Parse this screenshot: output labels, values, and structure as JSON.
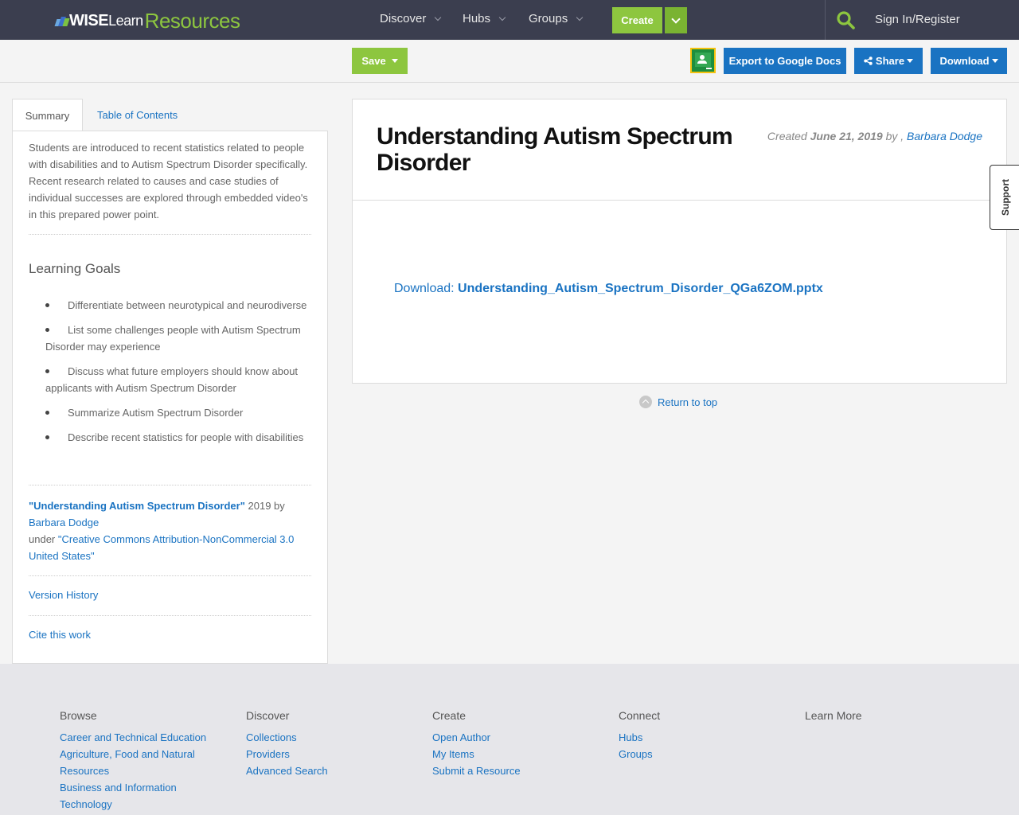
{
  "navbar": {
    "logo": {
      "wise": "WISE",
      "learn": "Learn",
      "resources": "Resources"
    },
    "items": [
      {
        "label": "Discover"
      },
      {
        "label": "Hubs"
      },
      {
        "label": "Groups"
      }
    ],
    "create_label": "Create",
    "signin_label": "Sign In/Register"
  },
  "toolbar": {
    "save_label": "Save",
    "export_label": "Export to Google Docs",
    "share_label": "Share",
    "download_label": "Download"
  },
  "tabs": {
    "summary": "Summary",
    "toc": "Table of Contents"
  },
  "summary": {
    "text": "Students are introduced to recent statistics related to people with disabilities and to Autism Spectrum Disorder specifically. Recent research related to causes and case studies of individual successes are explored through embedded video's in this prepared power point.",
    "learning_goals_heading": "Learning Goals",
    "goals": [
      "Differentiate between neurotypical and neurodiverse",
      "List some challenges people with Autism Spectrum Disorder may experience",
      "Discuss what future employers should know about applicants with Autism Spectrum Disorder",
      "Summarize Autism Spectrum Disorder",
      "Describe recent statistics for people with disabilities"
    ],
    "attribution": {
      "title": "\"Understanding Autism Spectrum Disorder\"",
      "year_by": " 2019 by ",
      "author": "Barbara Dodge",
      "under": "under ",
      "license": "\"Creative Commons Attribution-NonCommercial 3.0 United States\""
    },
    "version_history": "Version History",
    "cite": "Cite this work"
  },
  "resource": {
    "title": "Understanding Autism Spectrum Disorder",
    "created_label": "Created ",
    "created_date": "June 21, 2019",
    "by_label": " by , ",
    "author": "Barbara Dodge",
    "download_label": "Download: ",
    "download_file": "Understanding_Autism_Spectrum_Disorder_QGa6ZOM.pptx",
    "return_top": "Return to top",
    "support_label": "Support"
  },
  "footer": {
    "columns": [
      {
        "heading": "Browse",
        "links": [
          "Career and Technical Education",
          "Agriculture, Food and Natural Resources",
          "Business and Information Technology"
        ]
      },
      {
        "heading": "Discover",
        "links": [
          "Collections",
          "Providers",
          "Advanced Search"
        ]
      },
      {
        "heading": "Create",
        "links": [
          "Open Author",
          "My Items",
          "Submit a Resource"
        ]
      },
      {
        "heading": "Connect",
        "links": [
          "Hubs",
          "Groups"
        ]
      },
      {
        "heading": "Learn More",
        "links": []
      }
    ]
  },
  "colors": {
    "navbar": "#3b3e4f",
    "accent_green": "#8dc63f",
    "link_blue": "#1a73c2"
  }
}
